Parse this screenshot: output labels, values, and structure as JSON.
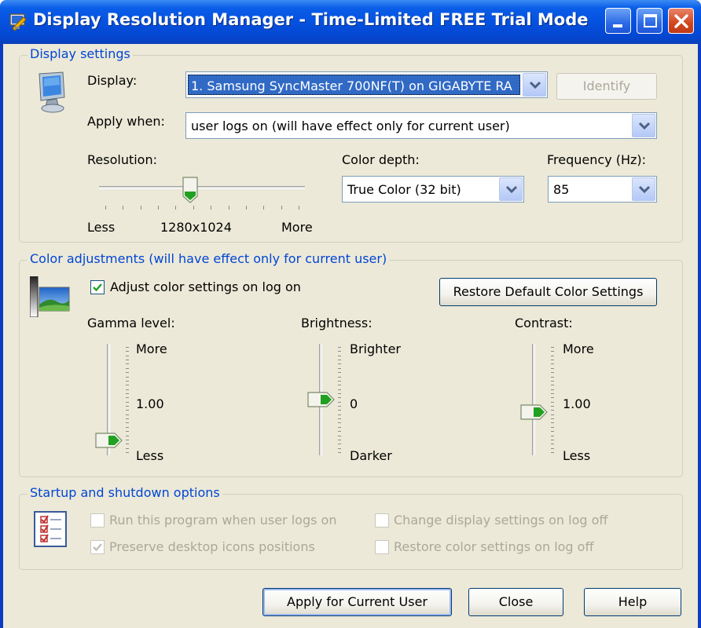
{
  "window": {
    "title": "Display Resolution Manager - Time-Limited FREE Trial Mode",
    "minimize": "_",
    "maximize": "□",
    "close": "✕"
  },
  "display_settings": {
    "group_label": "Display settings",
    "display_label": "Display:",
    "display_value": "1. Samsung SyncMaster 700NF(T) on GIGABYTE RA",
    "identify_label": "Identify",
    "apply_when_label": "Apply when:",
    "apply_when_value": "user logs on (will have effect only for current user)",
    "resolution_label": "Resolution:",
    "resolution_less": "Less",
    "resolution_value": "1280x1024",
    "resolution_more": "More",
    "resolution_position": 0.44,
    "color_depth_label": "Color depth:",
    "color_depth_value": "True Color (32 bit)",
    "frequency_label": "Frequency (Hz):",
    "frequency_value": "85"
  },
  "color_adjustments": {
    "group_label": "Color adjustments (will have effect only for current user)",
    "adjust_on_logon_label": "Adjust color settings on log on",
    "adjust_on_logon_checked": true,
    "restore_default_label": "Restore Default Color Settings",
    "gamma": {
      "label": "Gamma level:",
      "top": "More",
      "mid": "1.00",
      "bottom": "Less",
      "level": 0.1
    },
    "brightness": {
      "label": "Brightness:",
      "top": "Brighter",
      "mid": "0",
      "bottom": "Darker",
      "level": 0.5
    },
    "contrast": {
      "label": "Contrast:",
      "top": "More",
      "mid": "1.00",
      "bottom": "Less",
      "level": 0.38
    }
  },
  "startup_options": {
    "group_label": "Startup and shutdown options",
    "run_on_logon": {
      "label": "Run this program when user logs on",
      "checked": false
    },
    "preserve_icons": {
      "label": "Preserve desktop icons positions",
      "checked": true
    },
    "change_on_logoff": {
      "label": "Change display settings on log off",
      "checked": false
    },
    "restore_color_on_logoff": {
      "label": "Restore color settings on log off",
      "checked": false
    }
  },
  "footer": {
    "apply_label": "Apply for Current User",
    "close_label": "Close",
    "help_label": "Help"
  },
  "icons": [
    "app-icon",
    "monitor-icon",
    "color-image-icon",
    "checklist-icon"
  ],
  "colors": {
    "title_bar": "#0551e0",
    "group_label": "#0446d5",
    "dialog_bg": "#ece9d8",
    "close_button": "#d2461e"
  }
}
